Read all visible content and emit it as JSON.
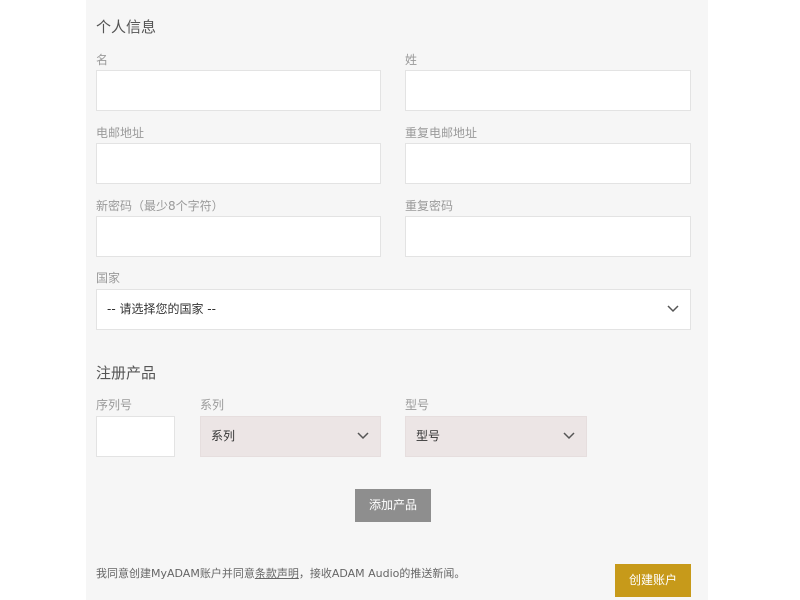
{
  "personal_info": {
    "title": "个人信息",
    "first_name_label": "名",
    "last_name_label": "姓",
    "email_label": "电邮地址",
    "repeat_email_label": "重复电邮地址",
    "new_password_label": "新密码（最少8个字符）",
    "repeat_password_label": "重复密码",
    "country_label": "国家",
    "country_selected": "-- 请选择您的国家 --"
  },
  "register_product": {
    "title": "注册产品",
    "serial_label": "序列号",
    "series_label": "系列",
    "series_selected": "系列",
    "model_label": "型号",
    "model_selected": "型号",
    "add_product_label": "添加产品"
  },
  "footer": {
    "consent_prefix": "我同意创建MyADAM账户并同意",
    "consent_link": "条款声明",
    "consent_suffix": "，接收ADAM Audio的推送新闻。",
    "create_account_label": "创建账户"
  },
  "colors": {
    "panel_bg": "#f6f6f6",
    "tinted_select_bg": "#ece5e5",
    "primary_button": "#c79a1a",
    "secondary_button": "#8e8e8e"
  },
  "icons": {
    "dropdown": "chevron-down-icon"
  }
}
